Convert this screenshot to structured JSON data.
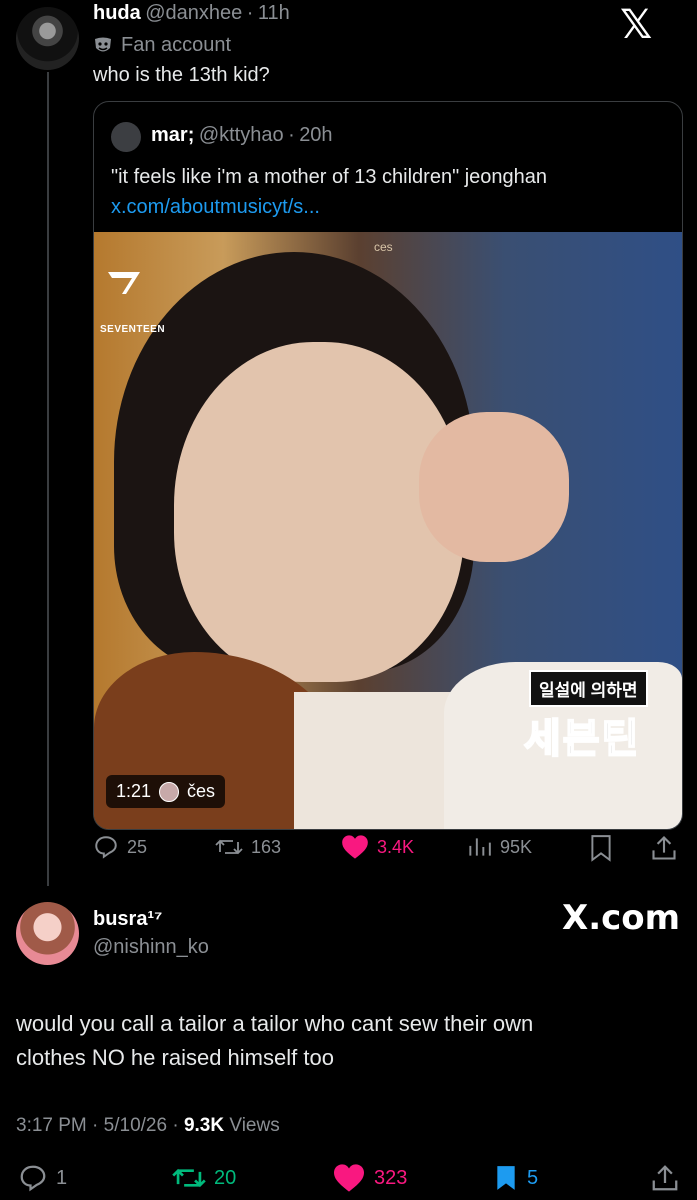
{
  "tweet1": {
    "name": "huda",
    "handle": "@danxhee",
    "time": "11h",
    "label": "Fan account",
    "text": "who is the 13th kid?"
  },
  "quote": {
    "name": "mar;",
    "handle": "@kttyhao",
    "time": "20h",
    "text": "\"it feels like i'm a mother of 13 children\" jeonghan",
    "link": "x.com/aboutmusicyt/s...",
    "media": {
      "logo_text": "SEVENTEEN",
      "korean_small": "일설에 의하면",
      "korean_large": "세븐틴",
      "watermark": "ces",
      "duration": "1:21",
      "uploader": "čes"
    }
  },
  "tweet1_actions": {
    "replies": "25",
    "reposts": "163",
    "likes": "3.4K",
    "views": "95K"
  },
  "tweet2": {
    "name": "busra¹⁷",
    "handle": "@nishinn_ko",
    "brand": "X.com",
    "text_line1": "would you call a tailor a tailor who cant sew their own",
    "text_line2": "clothes NO he raised himself too",
    "time": "3:17 PM",
    "date": "5/10/26",
    "views_count": "9.3K",
    "views_label": "Views"
  },
  "tweet2_actions": {
    "replies": "1",
    "reposts": "20",
    "likes": "323",
    "bookmarks": "5"
  },
  "colors": {
    "background": "#000000",
    "text": "#e7e9ea",
    "muted": "#8b8f94",
    "link": "#1d9bf0",
    "like": "#f91880",
    "repost": "#00ba7c",
    "bookmark": "#1d9bf0"
  }
}
